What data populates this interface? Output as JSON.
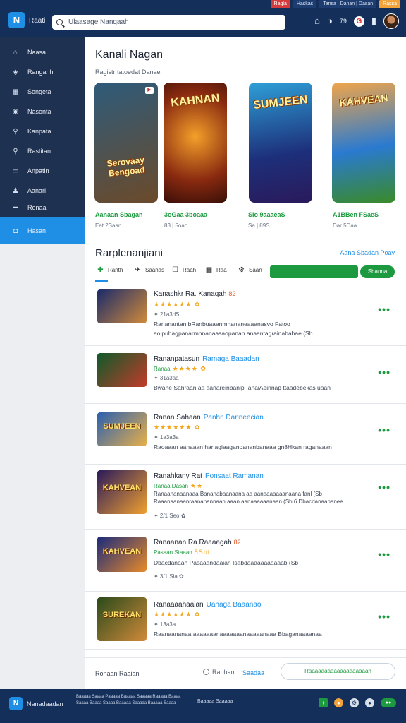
{
  "topbar": {
    "chips": [
      "Ragla",
      "Haskas",
      "Tansa | Danan | Dasan",
      "Rassa"
    ],
    "logo_text": "Raati",
    "search_value": "Ulaasage Nanqaah",
    "notif_count": "79",
    "icons": [
      "home-icon",
      "play-icon",
      "google-icon",
      "bookmark-icon",
      "avatar"
    ]
  },
  "sidebar": {
    "items": [
      {
        "label": "Naasa",
        "icon": "home-icon"
      },
      {
        "label": "Ranganh",
        "icon": "gamepad-icon"
      },
      {
        "label": "Songeta",
        "icon": "grid-icon"
      },
      {
        "label": "Nasonta",
        "icon": "compass-icon"
      },
      {
        "label": "Kanpata",
        "icon": "pin-icon"
      },
      {
        "label": "Rastitan",
        "icon": "search-icon"
      },
      {
        "label": "Anpatin",
        "icon": "tv-icon"
      },
      {
        "label": "Aanarl",
        "icon": "user-icon"
      },
      {
        "label": "Renaa",
        "icon": "line-icon"
      },
      {
        "label": "Hasan",
        "icon": "chat-icon"
      }
    ]
  },
  "main": {
    "title": "Kanali Nagan",
    "subtitle": "Ragistr tatoedat Danae",
    "cards": [
      {
        "title": "Serovaay Bengoad",
        "meta": "Aanaan Sbagan",
        "meta2": "Eat 2Saan",
        "colors": [
          "#2e5b7a",
          "#6b4a2a"
        ]
      },
      {
        "title": "KAHNAN",
        "meta": "3oGaa 3boaaa",
        "meta2": "83 | 5oao",
        "colors": [
          "#6b1d0f",
          "#e8711c"
        ]
      },
      {
        "title": "SUMJEEN",
        "meta": "Sio 9aaaeaS",
        "meta2": "Sa | 89S",
        "colors": [
          "#1d2f7a",
          "#2e9fd6"
        ]
      },
      {
        "title": "KAHVEAN",
        "meta": "A1BBen FSaeS",
        "meta2": "Dar 5Daa",
        "colors": [
          "#2a7ad0",
          "#f0a54a"
        ]
      }
    ],
    "section_title": "Rarplenanjiani",
    "section_link": "Aana Sbadan Poay",
    "filters": [
      {
        "label": "Ranth",
        "icon": "puzzle-icon"
      },
      {
        "label": "Saanas",
        "icon": "controller-icon"
      },
      {
        "label": "Raah",
        "icon": "rating-icon"
      },
      {
        "label": "Raa",
        "icon": "chart-icon"
      },
      {
        "label": "Saan",
        "icon": "settings-icon"
      }
    ],
    "filter_button": "Sbanna",
    "list": [
      {
        "title": "Kanashkr Ra. Kanaqah",
        "tag": "",
        "tag2": "82",
        "stars_label": "",
        "stars": "★★★★★★ ✿",
        "small": "✦ 21a3dS",
        "desc": "Rananantan bRanbuaaenmnananeaaanasvo Fatoo aoipuhagpanarmnnanaasaopanan anaantagrainabahae (Sb",
        "colors": [
          "#1a2a6b",
          "#d08a3a"
        ],
        "thumb_text": ""
      },
      {
        "title": "Rananpatasun",
        "tag": "Ramaga Baaadan",
        "tag2": "",
        "stars_label": "Ranaa",
        "stars": "★★★★ ✿",
        "small": "✦ 31a3aa",
        "desc": "Bwahe Sahraan aa aanareinbanlpFanaiAeirinap ttaadebekas uaan",
        "colors": [
          "#0f5a2a",
          "#c23b2a"
        ],
        "thumb_text": ""
      },
      {
        "title": "Ranan Sahaan",
        "tag": "Panhn Danneecian",
        "tag2": "",
        "stars_label": "",
        "stars": "★★★★★★ ✿",
        "small": "✦ 1a3a3a",
        "desc": "Raoaaan aanaaan hanagiaaganoananbanaaa gn8Hkan raganaaan",
        "colors": [
          "#2a5fb0",
          "#e8b04a"
        ],
        "thumb_text": "SUMJEEN"
      },
      {
        "title": "Ranahkany Rat",
        "tag": "Ponsaat Ramanan",
        "tag2": "",
        "stars_label": "Ranaa Dasan",
        "stars": "★★",
        "small": "✦ 2/1 Seo  ✿",
        "desc": "Ranaananaanaaa Bananabaanaana aa aanaaaaaaanaana fanl (Sb Raaanaanaanraananannaan aaan aanaaaaaanaan (Sb 6 Dbacdanaananee",
        "colors": [
          "#2a1a5b",
          "#f0a030"
        ],
        "thumb_text": "KAHVEAN"
      },
      {
        "title": "Ranaanan Ra.Raaaagah",
        "tag": "",
        "tag2": "82",
        "stars_label": "Pasaan Staaan",
        "stars": "5Sbt",
        "small": "✦ 3/1 Sia  ✿",
        "desc": "Dbacdanaan Pasaaandaaian Isabdaaaaaaaaaaab (Sb",
        "colors": [
          "#1a2a7b",
          "#e88a2a"
        ],
        "thumb_text": "KAHVEAN"
      },
      {
        "title": "Ranaaaahaaian",
        "tag": "Uahaga Baaanao",
        "tag2": "",
        "stars_label": "",
        "stars": "★★★★★★ ✿",
        "small": "✦ 13a3a",
        "desc": "Raanaananaa aaaaaaanaaaaaaanaaaaanaaa Bbaganaaaanaa",
        "colors": [
          "#2a4a1a",
          "#d08a3a"
        ],
        "thumb_text": "SUREKAN"
      }
    ]
  },
  "pager": {
    "left": "Ronaan Raaian",
    "middle": "Raphan",
    "link": "Saadaa",
    "button": "Raaaaaaaaaaaaaaaaaaah"
  },
  "footer": {
    "name": "Nanadaadan",
    "links1": "Baaaaa Saaaa Paaaaa Baaaaa Saaaaa Raaaaa Baaaa",
    "links2": "Saaaa Baaaa Saaaa Baaaaa Saaaaa Baaaaa Saaaa",
    "copy": "Baaaaa Saaaaa"
  }
}
